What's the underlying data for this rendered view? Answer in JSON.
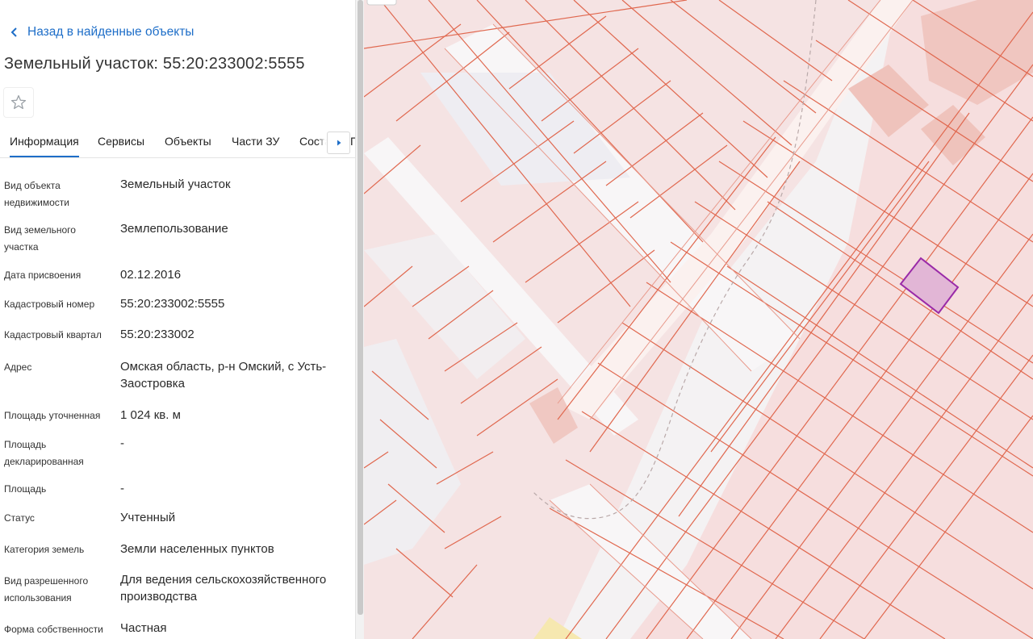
{
  "header": {
    "back_label": "Назад в найденные объекты",
    "title": "Земельный участок: 55:20:233002:5555"
  },
  "tabs": [
    {
      "label": "Информация",
      "active": true
    },
    {
      "label": "Сервисы",
      "active": false
    },
    {
      "label": "Объекты",
      "active": false
    },
    {
      "label": "Части ЗУ",
      "active": false
    },
    {
      "label": "Соста",
      "active": false
    },
    {
      "label": "П",
      "active": false
    }
  ],
  "info": [
    {
      "label": "Вид объекта недвижимости",
      "value": "Земельный участок"
    },
    {
      "label": "Вид земельного участка",
      "value": "Землепользование"
    },
    {
      "label": "Дата присвоения",
      "value": "02.12.2016"
    },
    {
      "label": "Кадастровый номер",
      "value": "55:20:233002:5555"
    },
    {
      "label": "Кадастровый квартал",
      "value": "55:20:233002"
    },
    {
      "label": "Адрес",
      "value": "Омская область, р-н Омский, с Усть-Заостровка"
    },
    {
      "label": "Площадь уточненная",
      "value": "1 024 кв. м"
    },
    {
      "label": "Площадь декларированная",
      "value": "-"
    },
    {
      "label": "Площадь",
      "value": "-"
    },
    {
      "label": "Статус",
      "value": "Учтенный"
    },
    {
      "label": "Категория земель",
      "value": "Земли населенных пунктов"
    },
    {
      "label": "Вид разрешенного использования",
      "value": "Для ведения сельскохозяйственного производства"
    },
    {
      "label": "Форма собственности",
      "value": "Частная"
    }
  ],
  "icons": {
    "back": "chevron-left-icon",
    "favorite": "star-outline-icon",
    "tabs_next": "caret-right-icon"
  },
  "colors": {
    "accent": "#1e6ec8",
    "parcel_fill": "#f5dcdc",
    "parcel_stroke": "#e0684f",
    "selected_fill": "#e2b6d6",
    "selected_stroke": "#9a2aa8"
  }
}
